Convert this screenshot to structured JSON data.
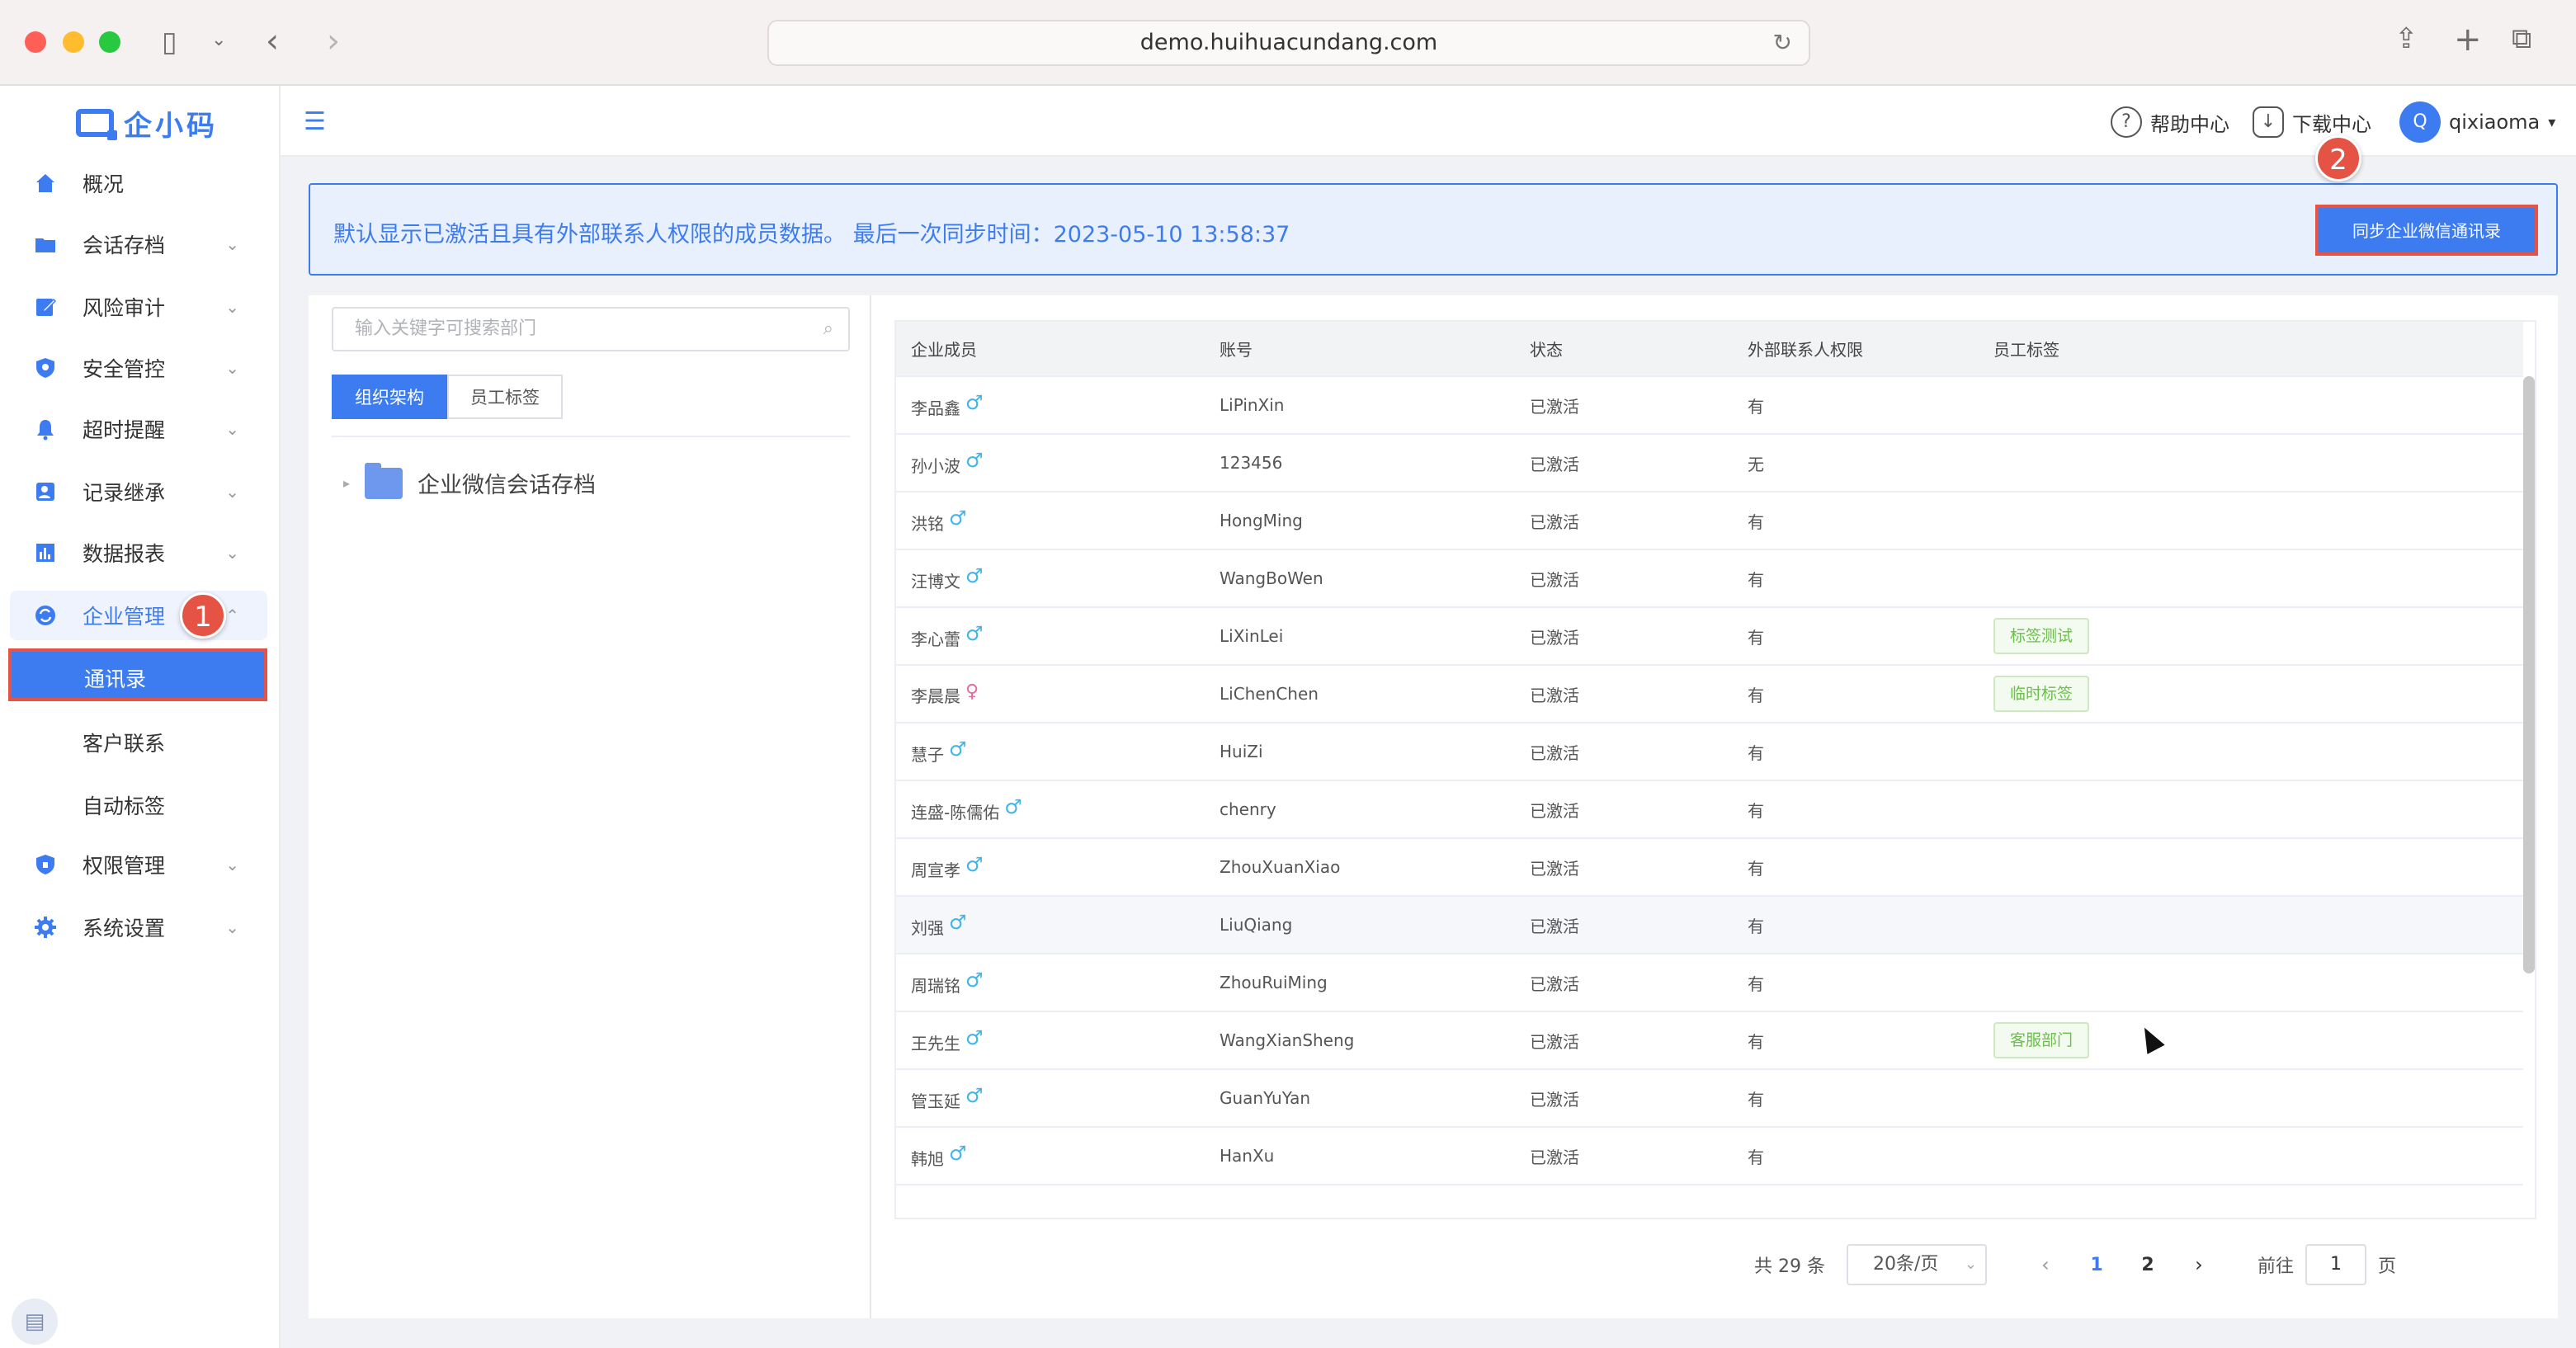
{
  "browser": {
    "url": "demo.huihuacundang.com",
    "traffic_colors": [
      "#ff5f57",
      "#febc2e",
      "#28c840"
    ]
  },
  "app": {
    "logo_text": "企小码",
    "nav": [
      {
        "label": "概况",
        "icon": "home-icon",
        "has_chevron": false
      },
      {
        "label": "会话存档",
        "icon": "folder-icon",
        "has_chevron": true
      },
      {
        "label": "风险审计",
        "icon": "edit-icon",
        "has_chevron": true
      },
      {
        "label": "安全管控",
        "icon": "shield-icon",
        "has_chevron": true
      },
      {
        "label": "超时提醒",
        "icon": "bell-icon",
        "has_chevron": true
      },
      {
        "label": "记录继承",
        "icon": "user-transfer-icon",
        "has_chevron": true
      },
      {
        "label": "数据报表",
        "icon": "bar-chart-icon",
        "has_chevron": true
      },
      {
        "label": "企业管理",
        "icon": "sync-icon",
        "has_chevron": true,
        "expanded": true
      },
      {
        "label": "权限管理",
        "icon": "lock-shield-icon",
        "has_chevron": true
      },
      {
        "label": "系统设置",
        "icon": "gear-icon",
        "has_chevron": true
      }
    ],
    "sub_nav": [
      {
        "label": "通讯录",
        "selected": true
      },
      {
        "label": "客户联系",
        "selected": false
      },
      {
        "label": "自动标签",
        "selected": false
      }
    ],
    "step_badges": [
      "1",
      "2"
    ],
    "topbar": {
      "help": "帮助中心",
      "download": "下载中心",
      "avatar_letter": "Q",
      "username": "qixiaoma"
    },
    "notice": {
      "text": "默认显示已激活且具有外部联系人权限的成员数据。 最后一次同步时间：2023-05-10 13:58:37",
      "sync_button": "同步企业微信通讯录"
    },
    "left_panel": {
      "search_placeholder": "输入关键字可搜索部门",
      "tabs": [
        "组织架构",
        "员工标签"
      ],
      "tree_root": "企业微信会话存档"
    },
    "table": {
      "headers": [
        "企业成员",
        "账号",
        "状态",
        "外部联系人权限",
        "员工标签"
      ],
      "rows": [
        {
          "name": "李品鑫",
          "gender": "male",
          "account": "LiPinXin",
          "status": "已激活",
          "perm": "有",
          "tag": ""
        },
        {
          "name": "孙小波",
          "gender": "male",
          "account": "123456",
          "status": "已激活",
          "perm": "无",
          "tag": ""
        },
        {
          "name": "洪铭",
          "gender": "male",
          "account": "HongMing",
          "status": "已激活",
          "perm": "有",
          "tag": ""
        },
        {
          "name": "汪博文",
          "gender": "male",
          "account": "WangBoWen",
          "status": "已激活",
          "perm": "有",
          "tag": ""
        },
        {
          "name": "李心蕾",
          "gender": "male",
          "account": "LiXinLei",
          "status": "已激活",
          "perm": "有",
          "tag": "标签测试"
        },
        {
          "name": "李晨晨",
          "gender": "female",
          "account": "LiChenChen",
          "status": "已激活",
          "perm": "有",
          "tag": "临时标签"
        },
        {
          "name": "慧子",
          "gender": "male",
          "account": "HuiZi",
          "status": "已激活",
          "perm": "有",
          "tag": ""
        },
        {
          "name": "连盛-陈儒佑",
          "gender": "male",
          "account": "chenry",
          "status": "已激活",
          "perm": "有",
          "tag": ""
        },
        {
          "name": "周宣孝",
          "gender": "male",
          "account": "ZhouXuanXiao",
          "status": "已激活",
          "perm": "有",
          "tag": ""
        },
        {
          "name": "刘强",
          "gender": "male",
          "account": "LiuQiang",
          "status": "已激活",
          "perm": "有",
          "tag": "",
          "highlight": true
        },
        {
          "name": "周瑞铭",
          "gender": "male",
          "account": "ZhouRuiMing",
          "status": "已激活",
          "perm": "有",
          "tag": ""
        },
        {
          "name": "王先生",
          "gender": "male",
          "account": "WangXianSheng",
          "status": "已激活",
          "perm": "有",
          "tag": "客服部门"
        },
        {
          "name": "管玉延",
          "gender": "male",
          "account": "GuanYuYan",
          "status": "已激活",
          "perm": "有",
          "tag": ""
        },
        {
          "name": "韩旭",
          "gender": "male",
          "account": "HanXu",
          "status": "已激活",
          "perm": "有",
          "tag": ""
        }
      ]
    },
    "pagination": {
      "total": "共 29 条",
      "page_size": "20条/页",
      "pages": [
        "1",
        "2"
      ],
      "current": "1",
      "goto_prefix": "前往",
      "goto_value": "1",
      "goto_suffix": "页"
    },
    "colors": {
      "accent": "#3d7cf0",
      "highlight_border": "#e55345",
      "tag_green": "#6bbf4a"
    }
  }
}
